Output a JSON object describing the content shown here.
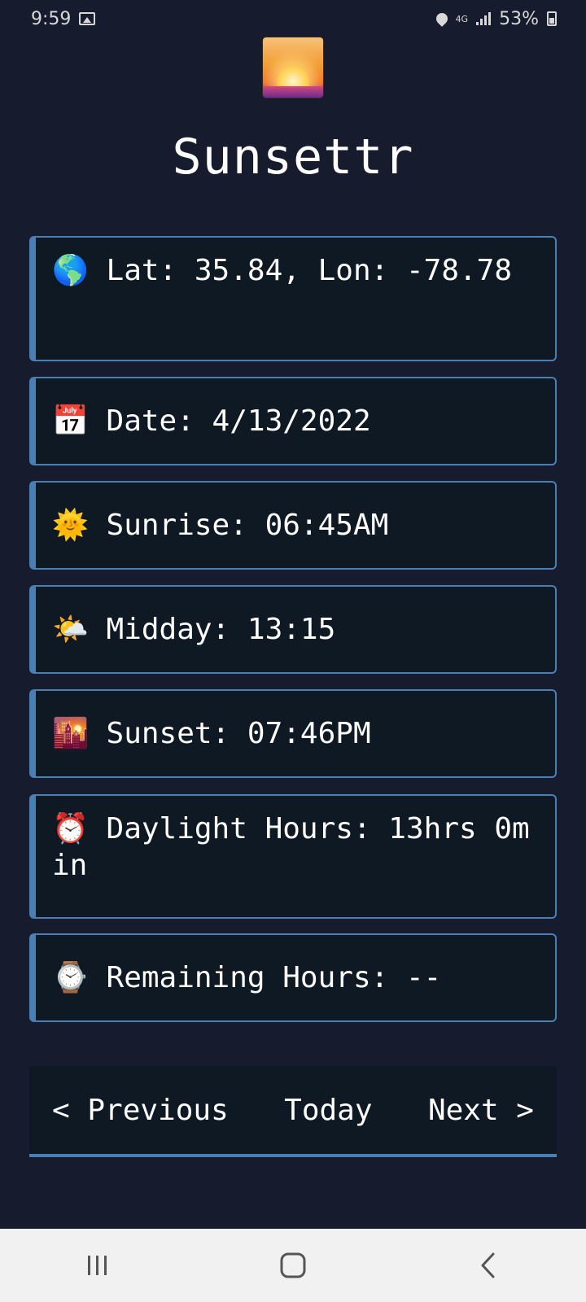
{
  "status_bar": {
    "time": "9:59",
    "battery_percent": "53%",
    "network": "4G"
  },
  "app": {
    "title": "Sunsettr"
  },
  "cards": [
    {
      "emoji": "🌎",
      "text": "Lat: 35.84, Lon: -78.78"
    },
    {
      "emoji": "📅",
      "text": "Date: 4/13/2022"
    },
    {
      "emoji": "🌞",
      "text": "Sunrise: 06:45AM"
    },
    {
      "emoji": "🌤️",
      "text": "Midday: 13:15"
    },
    {
      "emoji": "🌇",
      "text": "Sunset: 07:46PM"
    },
    {
      "emoji": "⏰",
      "text": "Daylight Hours: 13hrs 0min"
    },
    {
      "emoji": "⌚",
      "text": "Remaining Hours: --"
    }
  ],
  "navigation": {
    "previous_label": "< Previous",
    "today_label": "Today",
    "next_label": "Next >"
  },
  "colors": {
    "background": "#161c2e",
    "card_background": "#0f1923",
    "accent": "#4a7fb5"
  }
}
